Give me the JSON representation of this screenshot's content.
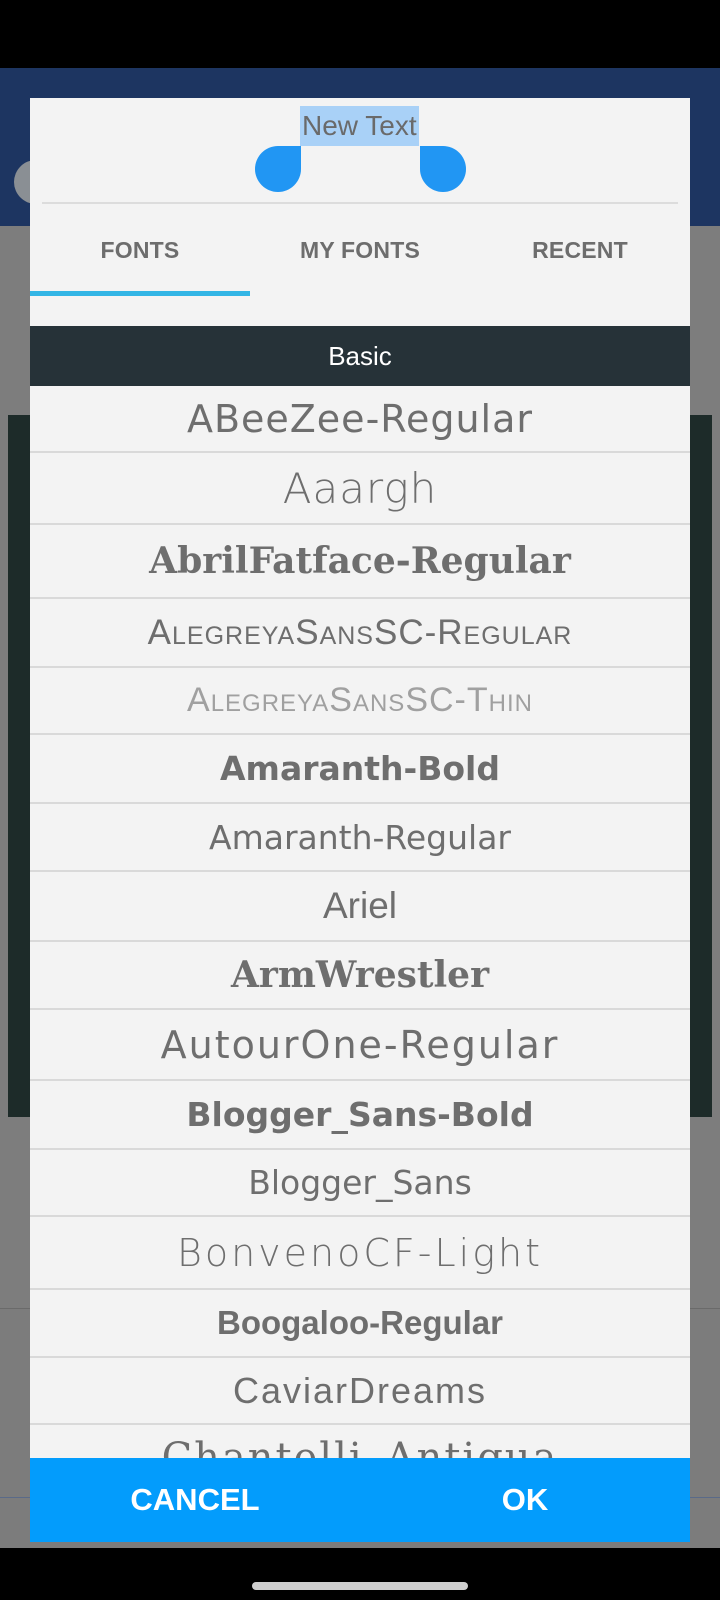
{
  "preview": {
    "text": "New Text"
  },
  "tabs": [
    {
      "label": "FONTS",
      "active": true
    },
    {
      "label": "MY FONTS",
      "active": false
    },
    {
      "label": "RECENT",
      "active": false
    }
  ],
  "list": {
    "section": "Basic",
    "fonts": [
      "ABeeZee-Regular",
      "Aaargh",
      "AbrilFatface-Regular",
      "AlegreyaSansSC-Regular",
      "AlegreyaSansSC-Thin",
      "Amaranth-Bold",
      "Amaranth-Regular",
      "Ariel",
      "ArmWrestler",
      "AutourOne-Regular",
      "Blogger_Sans-Bold",
      "Blogger_Sans",
      "BonvenoCF-Light",
      "Boogaloo-Regular",
      "CaviarDreams",
      "Chantelli_Antiqua"
    ]
  },
  "buttons": {
    "cancel": "CANCEL",
    "ok": "OK"
  },
  "colors": {
    "accent": "#039cfc",
    "tab_indicator": "#33b5e5",
    "section_header": "#263238",
    "selection_handle": "#2196f3",
    "text_selection": "#a9d1f7"
  }
}
